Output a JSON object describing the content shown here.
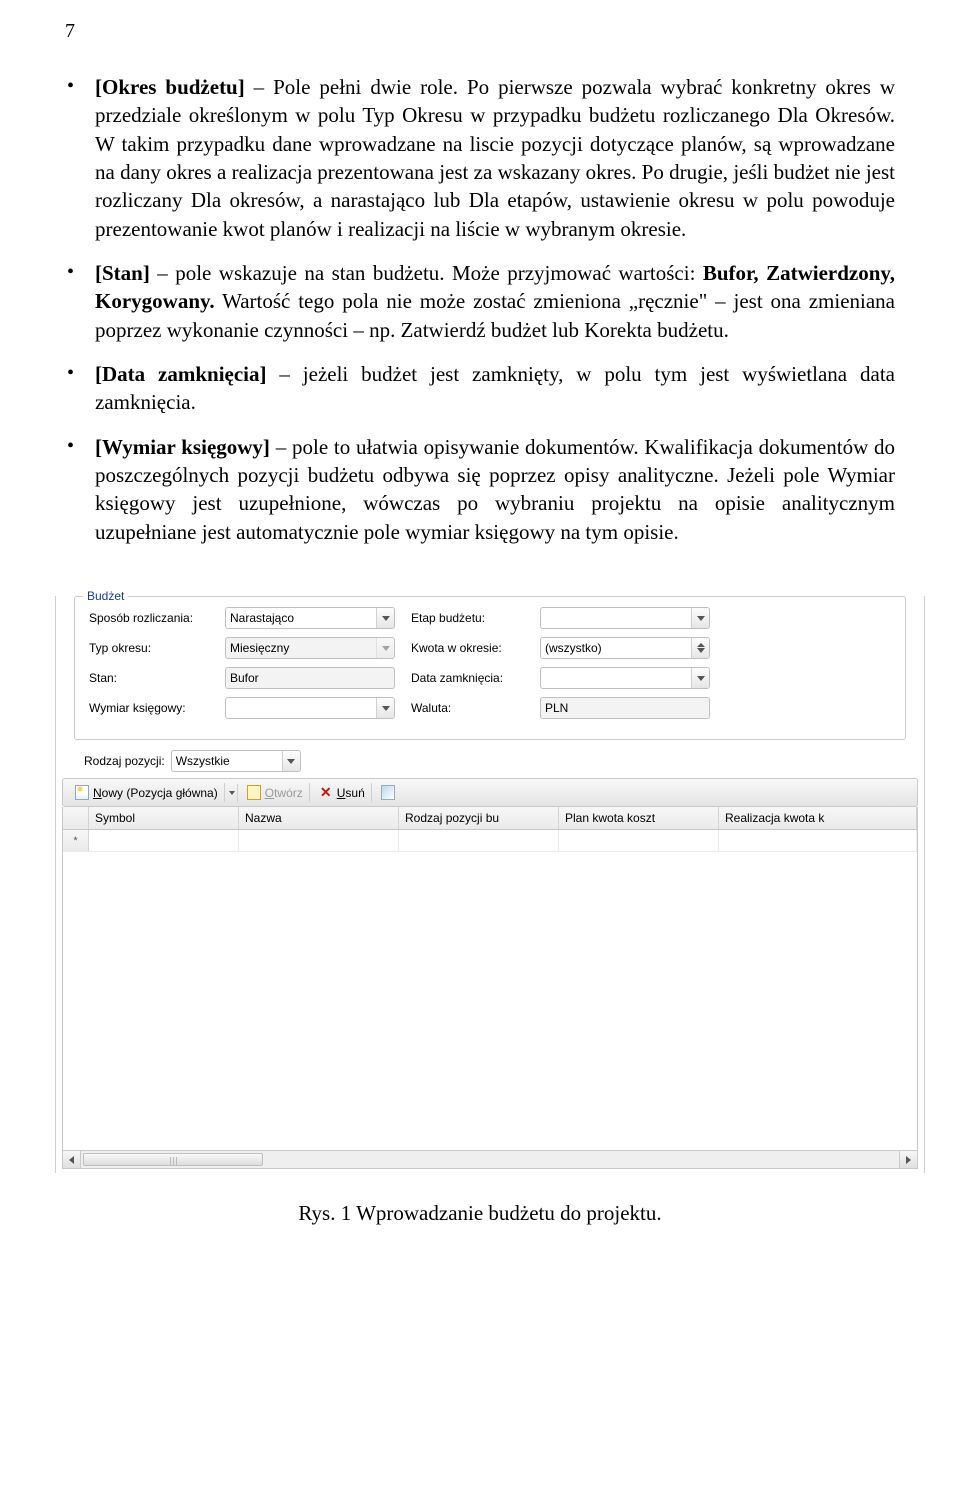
{
  "page_number": "7",
  "bullets": {
    "okres": {
      "label": "[Okres budżetu]",
      "text": " – Pole pełni dwie role. Po pierwsze pozwala wybrać konkretny okres w przedziale określonym w polu Typ Okresu w przypadku budżetu rozliczanego Dla Okresów. W takim przypadku dane wprowadzane na liscie pozycji dotyczące planów, są wprowadzane na dany okres a realizacja prezentowana jest za wskazany okres. Po drugie, jeśli budżet nie jest rozliczany Dla okresów, a narastająco lub Dla etapów, ustawienie okresu w polu powoduje prezentowanie kwot planów i realizacji na liście w wybranym okresie."
    },
    "stan": {
      "label": "[Stan]",
      "text_a": " – pole wskazuje na stan budżetu. Może przyjmować wartości: ",
      "values": "Bufor, Zatwierdzony, Korygowany.",
      "text_b": " Wartość tego pola nie może zostać zmieniona „ręcznie\" – jest ona zmieniana poprzez wykonanie czynności – np. Zatwierdź budżet lub Korekta budżetu."
    },
    "data_z": {
      "label": "[Data zamknięcia]",
      "text": " – jeżeli budżet jest zamknięty, w polu tym jest wyświetlana data zamknięcia."
    },
    "wymiar": {
      "label": "[Wymiar księgowy]",
      "text": " – pole to ułatwia opisywanie dokumentów. Kwalifikacja dokumentów do poszczególnych pozycji budżetu odbywa się poprzez opisy analityczne. Jeżeli pole Wymiar księgowy jest uzupełnione, wówczas po wybraniu projektu na opisie analitycznym uzupełniane jest automatycznie pole wymiar księgowy na tym opisie."
    }
  },
  "panel": {
    "legend": "Budżet",
    "left_labels": {
      "sposob": "Sposób rozliczania:",
      "typ": "Typ okresu:",
      "stan": "Stan:",
      "wymiar": "Wymiar księgowy:"
    },
    "right_labels": {
      "etap": "Etap budżetu:",
      "kwota": "Kwota w okresie:",
      "data_z": "Data zamknięcia:",
      "waluta": "Waluta:"
    },
    "values": {
      "sposob": "Narastająco",
      "typ": "Miesięczny",
      "stan": "Bufor",
      "wymiar": "",
      "etap": "",
      "kwota": "(wszystko)",
      "data_z": "",
      "waluta": "PLN"
    },
    "rodzaj_label": "Rodzaj pozycji:",
    "rodzaj_value": "Wszystkie",
    "toolbar": {
      "nowy": "Nowy (Pozycja główna)",
      "otworz": "Otwórz",
      "usun": "Usuń"
    },
    "columns": {
      "symbol": "Symbol",
      "nazwa": "Nazwa",
      "rodzaj": "Rodzaj pozycji bu",
      "plan": "Plan kwota koszt",
      "real": "Realizacja kwota k"
    },
    "row_marker": "*"
  },
  "caption": "Rys.  1 Wprowadzanie budżetu do projektu."
}
